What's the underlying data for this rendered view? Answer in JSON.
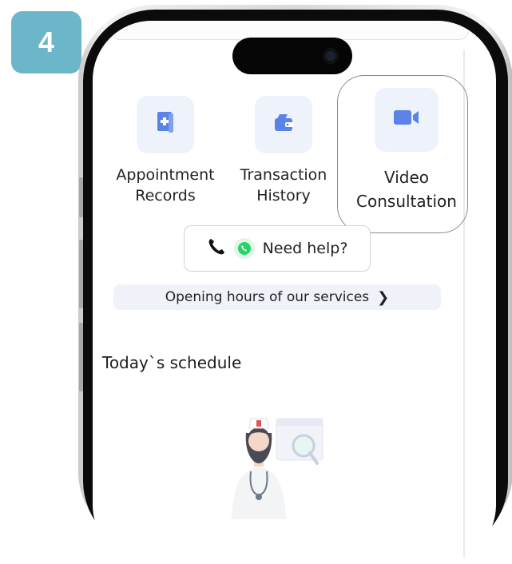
{
  "step": {
    "number": "4"
  },
  "services": [
    {
      "id": "appointment-records",
      "lines": [
        "Appointment",
        "Records"
      ],
      "icon": "medical-record-icon"
    },
    {
      "id": "transaction-history",
      "lines": [
        "Transaction",
        "History"
      ],
      "icon": "wallet-icon"
    },
    {
      "id": "video-consultation",
      "lines": [
        "Video",
        "Consultation"
      ],
      "icon": "video-camera-icon",
      "highlighted": true
    }
  ],
  "help": {
    "label": "Need help?",
    "icons": [
      "phone-icon",
      "whatsapp-icon"
    ]
  },
  "hours": {
    "label": "Opening hours of our services",
    "icon": "chevron-right-icon"
  },
  "schedule": {
    "title": "Today`s schedule",
    "illustration": "nurse-illustration"
  },
  "colors": {
    "badge": "#6bb6c8",
    "tile": "#eef2fb",
    "icon_blue": "#5b82e6",
    "whatsapp": "#25d366"
  }
}
